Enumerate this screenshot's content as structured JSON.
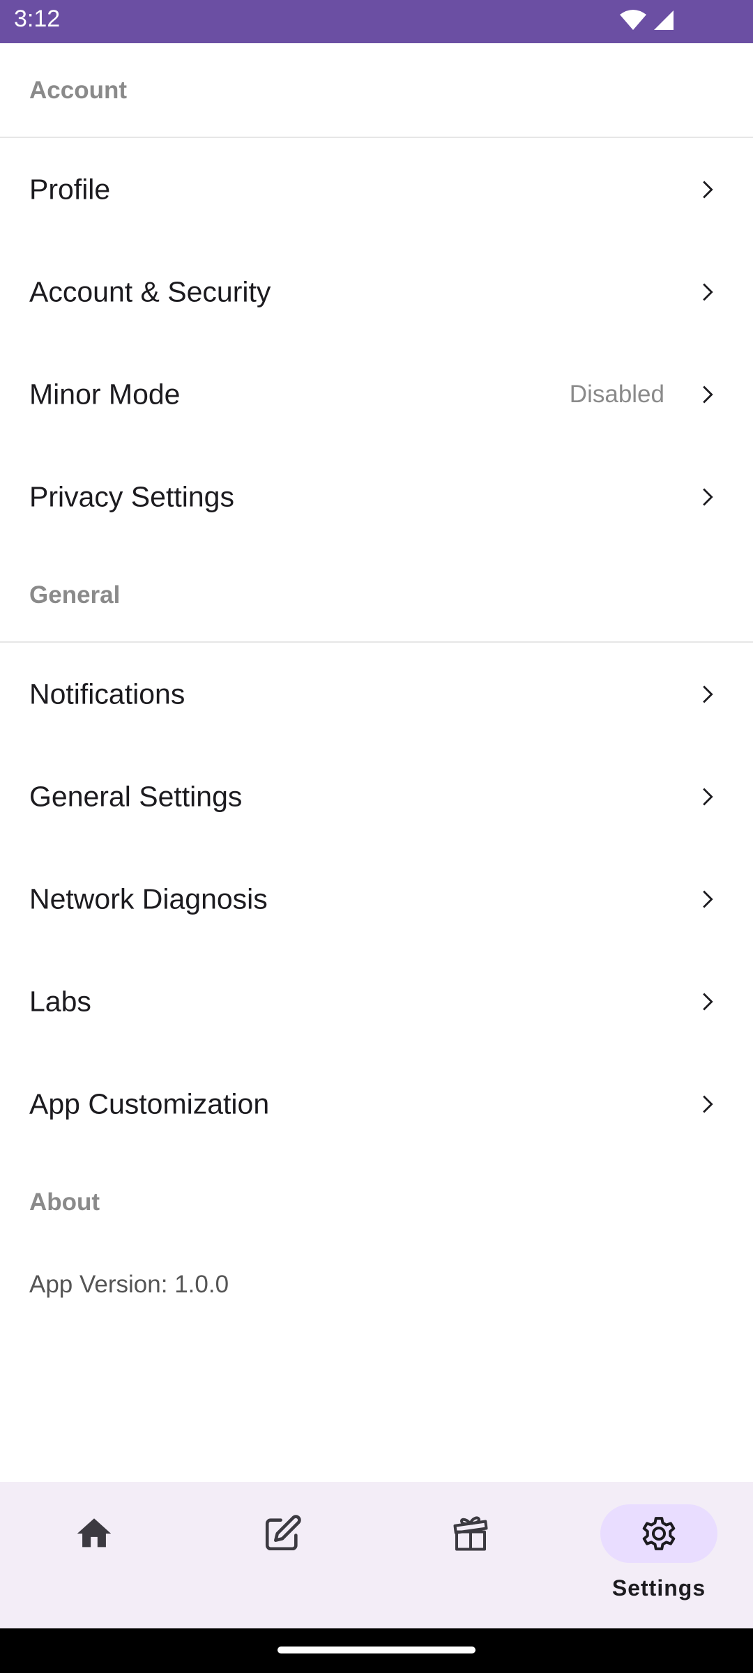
{
  "status_bar": {
    "time": "3:12",
    "background": "#6b4fa3",
    "icons": [
      "wifi-icon",
      "signal-icon"
    ]
  },
  "sections": {
    "account": {
      "header": "Account",
      "items": [
        {
          "label": "Profile"
        },
        {
          "label": "Account & Security"
        },
        {
          "label": "Minor Mode",
          "value": "Disabled"
        },
        {
          "label": "Privacy Settings"
        }
      ]
    },
    "general": {
      "header": "General",
      "items": [
        {
          "label": "Notifications"
        },
        {
          "label": "General Settings"
        },
        {
          "label": "Network Diagnosis"
        },
        {
          "label": "Labs"
        },
        {
          "label": "App Customization"
        }
      ]
    },
    "about": {
      "header": "About",
      "version": "App Version: 1.0.0"
    }
  },
  "bottom_nav": {
    "items": [
      {
        "icon": "home-icon",
        "label": ""
      },
      {
        "icon": "edit-icon",
        "label": ""
      },
      {
        "icon": "gift-icon",
        "label": ""
      },
      {
        "icon": "settings-icon",
        "label": "Settings",
        "active": true
      }
    ],
    "background": "#f3edf7",
    "active_indicator": "#e9ddff"
  }
}
